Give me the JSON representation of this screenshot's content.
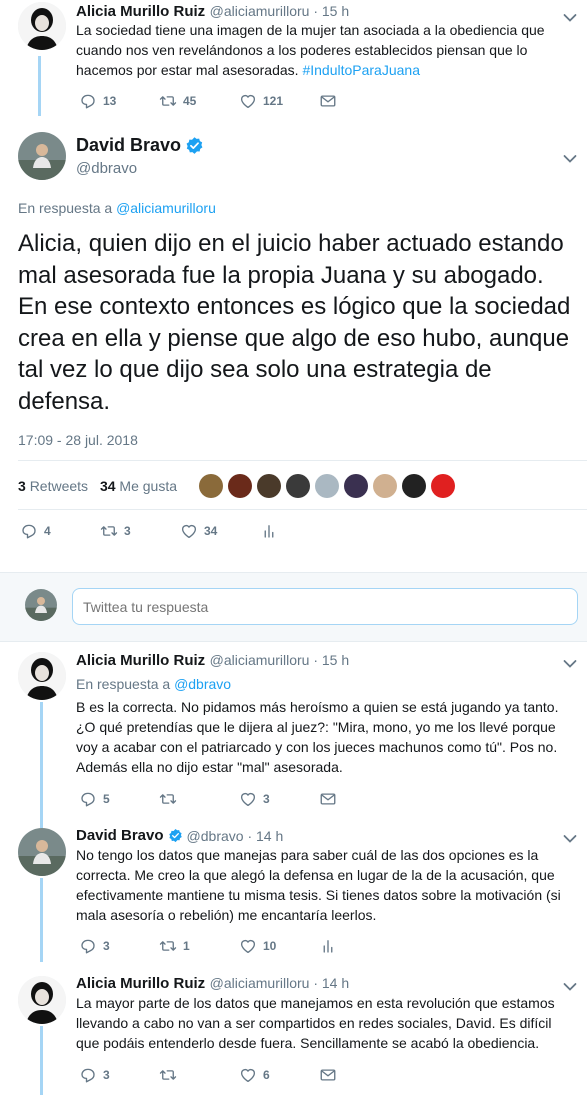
{
  "tweet1": {
    "name": "Alicia Murillo Ruiz",
    "meta": "@aliciamurilloru · 15 h",
    "text": "La sociedad tiene una imagen de la mujer tan asociada a la obediencia que cuando nos ven revelándonos a los poderes establecidos piensan que lo hacemos por estar mal asesoradas. ",
    "hashtag": "#IndultoParaJuana",
    "replies": "13",
    "retweets": "45",
    "likes": "121"
  },
  "main_tweet": {
    "name": "David Bravo",
    "handle": "@dbravo",
    "reply_prefix": "En respuesta a ",
    "reply_to": "@aliciamurilloru",
    "text": "Alicia, quien dijo en el juicio haber actuado estando mal asesorada fue la propia Juana y su abogado. En ese contexto entonces es lógico que la sociedad crea en ella y piense que algo de eso hubo, aunque tal vez lo que dijo sea solo una estrategia de defensa.",
    "timestamp": "17:09 - 28 jul. 2018",
    "retweet_count": "3",
    "retweet_label": "Retweets",
    "like_count": "34",
    "like_label": "Me gusta",
    "replies": "4",
    "retweets": "3",
    "likes": "34",
    "liker_avatar_colors": [
      "#8a6a3a",
      "#6a2a1a",
      "#4a3a2a",
      "#3a3a3a",
      "#aab8c2",
      "#3a3050",
      "#d0b090",
      "#222222",
      "#e02020"
    ]
  },
  "reply_box": {
    "placeholder": "Twittea tu respuesta"
  },
  "reply1": {
    "name": "Alicia Murillo Ruiz",
    "meta": "@aliciamurilloru · 15 h",
    "reply_prefix": "En respuesta a ",
    "reply_to": "@dbravo",
    "text": "B es la correcta. No pidamos más heroísmo a quien se está jugando ya tanto. ¿O qué pretendías que le dijera al juez?: \"Mira, mono, yo me los llevé porque voy a acabar con el patriarcado y con los jueces machunos como tú\". Pos no. Además ella no dijo estar \"mal\" asesorada.",
    "replies": "5",
    "retweets": "",
    "likes": "3"
  },
  "reply2": {
    "name": "David Bravo",
    "meta": "@dbravo · 14 h",
    "text": "No tengo los datos que manejas para saber cuál de las dos opciones es la correcta. Me creo la que alegó la defensa en lugar de la de la acusación, que efectivamente mantiene tu misma tesis. Si tienes datos sobre la motivación (si mala asesoría o rebelión) me encantaría leerlos.",
    "replies": "3",
    "retweets": "1",
    "likes": "10"
  },
  "reply3": {
    "name": "Alicia Murillo Ruiz",
    "meta": "@aliciamurilloru · 14 h",
    "text": "La mayor parte de los datos que manejamos en esta revolución que estamos llevando a cabo no van a ser compartidos en redes sociales, David. Es difícil que podáis entenderlo desde fuera. Sencillamente se acabó la obediencia.",
    "replies": "3",
    "retweets": "",
    "likes": "6"
  },
  "colors": {
    "accent": "#1da1f2",
    "thread_line": "#a5d5f5",
    "muted": "#657786",
    "verified": "#1da1f2"
  }
}
